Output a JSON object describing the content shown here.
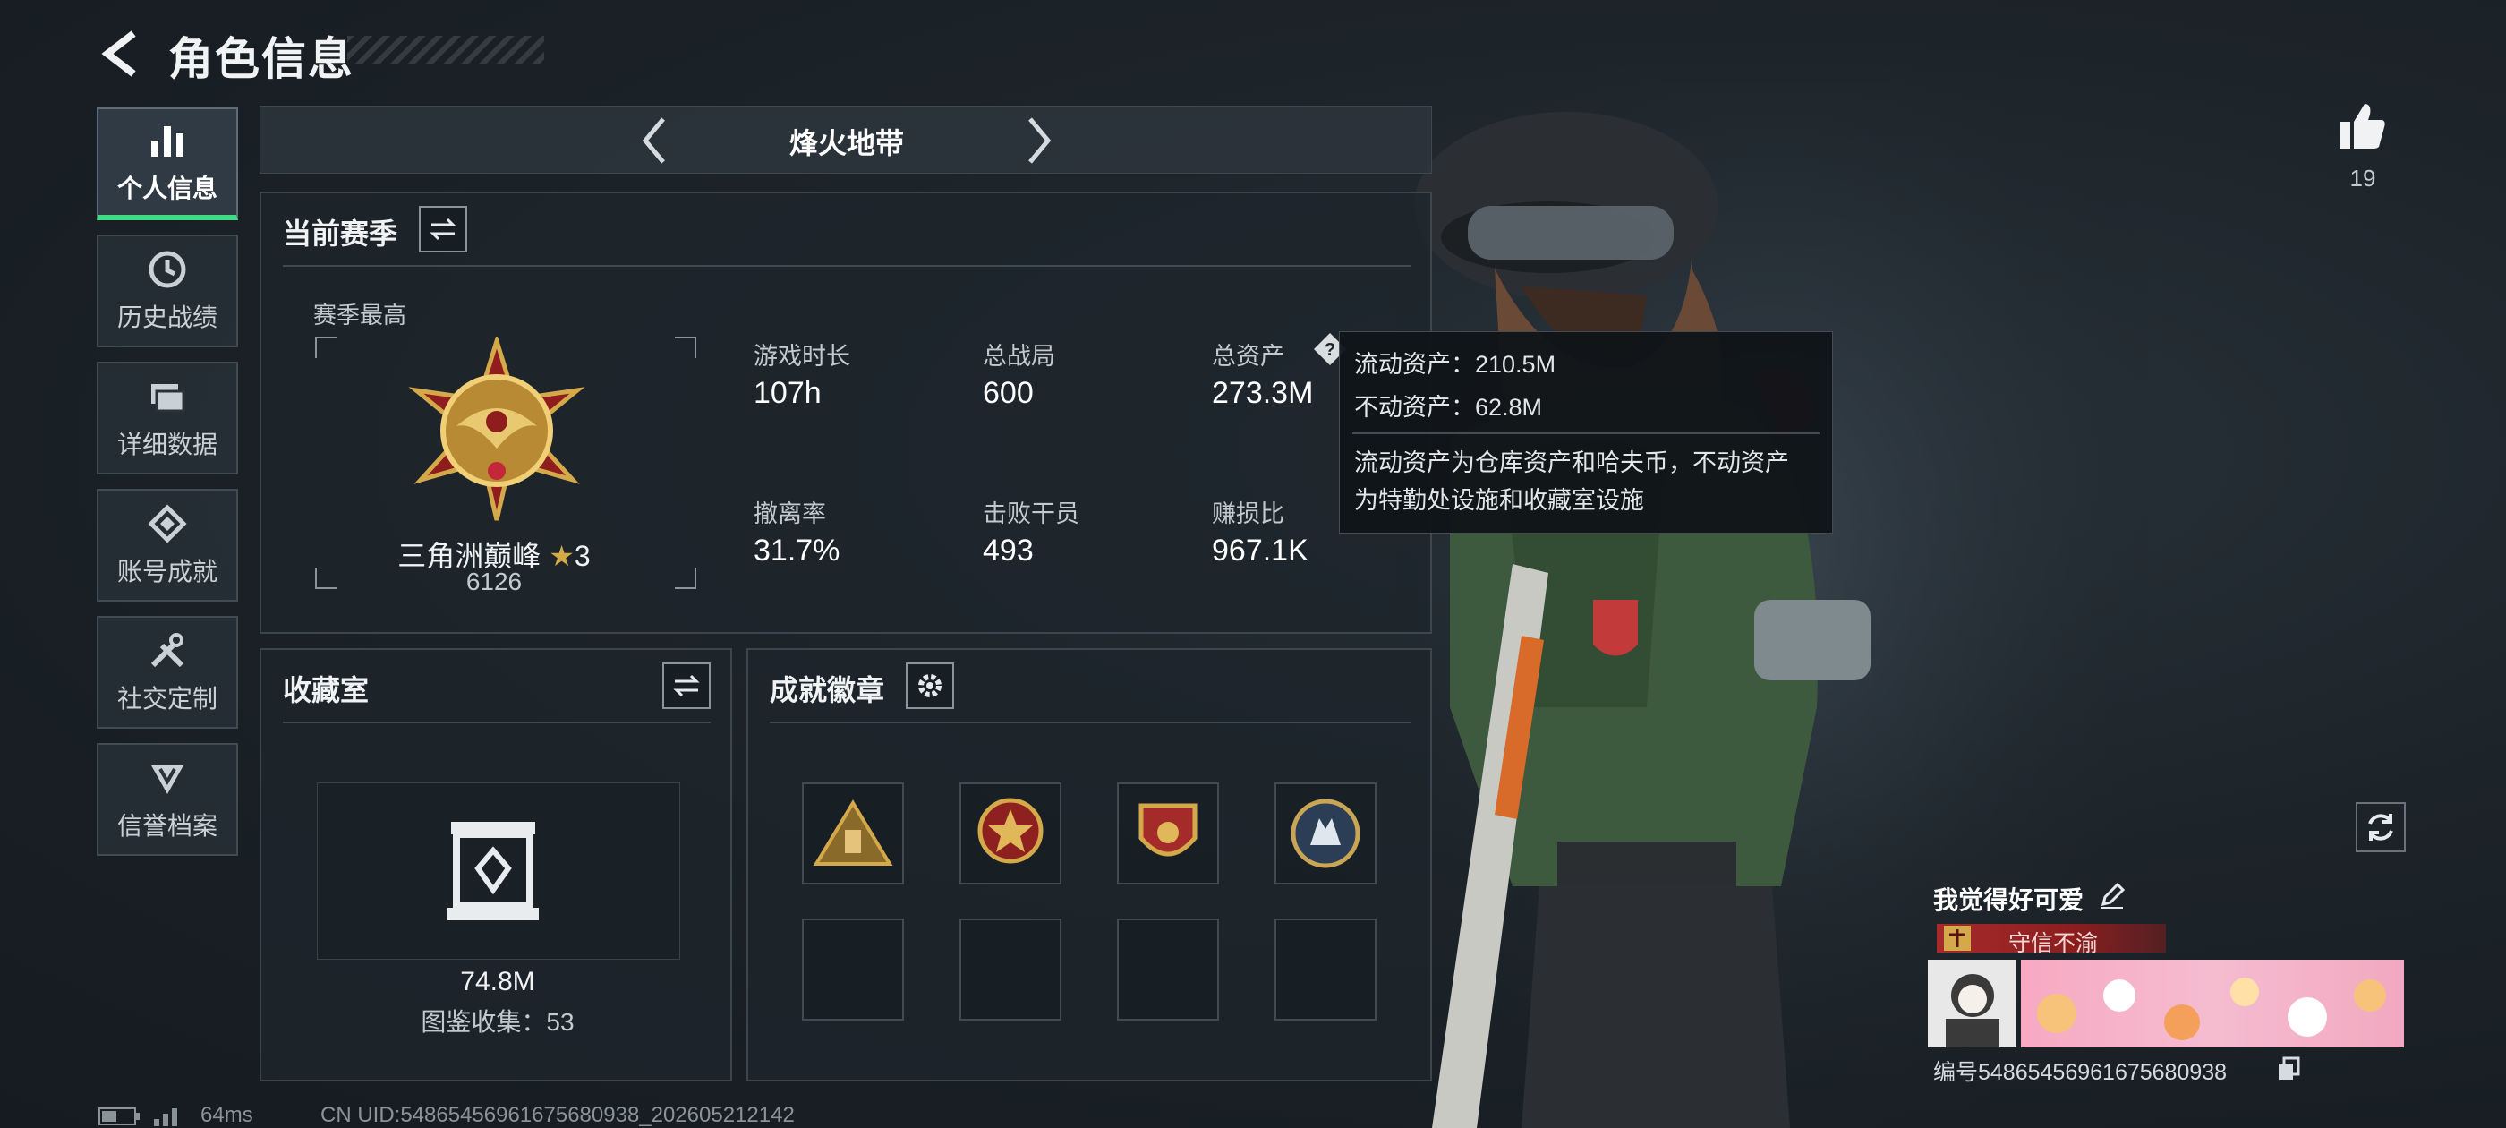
{
  "header": {
    "title": "角色信息"
  },
  "nav": {
    "items": [
      {
        "label": "个人信息",
        "icon": "bar-chart-icon",
        "active": true
      },
      {
        "label": "历史战绩",
        "icon": "history-clock-icon",
        "active": false
      },
      {
        "label": "详细数据",
        "icon": "folders-icon",
        "active": false
      },
      {
        "label": "账号成就",
        "icon": "achievement-diamond-icon",
        "active": false
      },
      {
        "label": "社交定制",
        "icon": "tools-icon",
        "active": false
      },
      {
        "label": "信誉档案",
        "icon": "credit-badge-icon",
        "active": false
      }
    ]
  },
  "mode": {
    "title": "烽火地带"
  },
  "season": {
    "title": "当前赛季",
    "best_label": "赛季最高",
    "rank_name": "三角洲巅峰",
    "rank_stars": "3",
    "rank_points": "6126",
    "stats": [
      {
        "label": "游戏时长",
        "value": "107h"
      },
      {
        "label": "总战局",
        "value": "600"
      },
      {
        "label": "总资产",
        "value": "273.3M"
      },
      {
        "label": "撤离率",
        "value": "31.7%"
      },
      {
        "label": "击败干员",
        "value": "493"
      },
      {
        "label": "赚损比",
        "value": "967.1K"
      }
    ]
  },
  "tooltip": {
    "liquid": "流动资产：210.5M",
    "fixed": "不动资产：62.8M",
    "desc_line1": "流动资产为仓库资产和哈夫币，不动资产",
    "desc_line2": "为特勤处设施和收藏室设施"
  },
  "collection": {
    "title": "收藏室",
    "value": "74.8M",
    "catalog": "图鉴收集：53"
  },
  "badges": {
    "title": "成就徽章"
  },
  "profile": {
    "likes": "19",
    "nickname": "我觉得好可爱",
    "reputation": "守信不渝",
    "id_text": "编号5486545696167568093​8"
  },
  "footer": {
    "ping": "64ms",
    "uid": "CN UID:54865456961675680938_202605212142"
  },
  "colors": {
    "accent": "#3ddc84",
    "reputation_bar": "#8b1e1e",
    "gold": "#d4a94a"
  }
}
